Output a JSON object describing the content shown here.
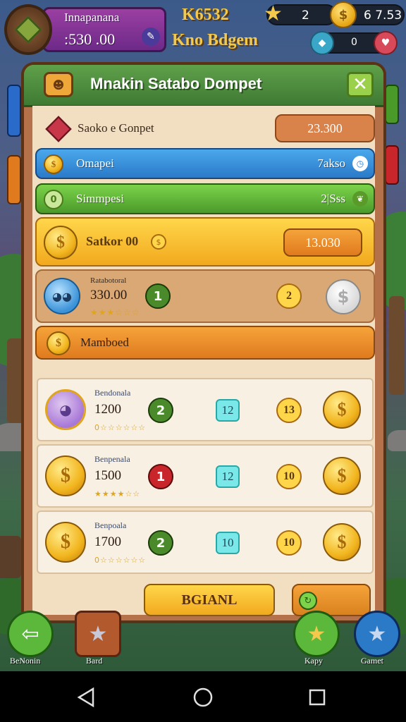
{
  "hud": {
    "player_name": "Innapanana",
    "player_balance": ":530 .00",
    "score_title": "K6532",
    "score_sub": "Kno Bdgem",
    "stars_count": "2",
    "coins_count": "6 7.53",
    "gems_count": "0"
  },
  "panel": {
    "title": "Mnakin Satabo Dompet",
    "header_row": {
      "label": "Saoko e Gonpet",
      "value": "23.300"
    },
    "blue_bar": {
      "label": "Omapei",
      "value": "7akso"
    },
    "green_bar": {
      "label": "Simmpesi",
      "value": "2|Sss"
    },
    "yellow_row": {
      "label": "Satkor 00",
      "value": "13.030"
    },
    "tan_row": {
      "name": "Ratabotoral",
      "amount": "330.00",
      "badge": "1",
      "stars": "★★★☆☆☆",
      "yellow_num": "2"
    },
    "orange_bar": {
      "label": "Mamboed"
    },
    "list": [
      {
        "name": "Bendonala",
        "amount": "1200",
        "badge": "2",
        "badge_color": "green",
        "stars": "0☆☆☆☆☆☆",
        "cyan": "12",
        "num": "13"
      },
      {
        "name": "Benpenala",
        "amount": "1500",
        "badge": "1",
        "badge_color": "red",
        "stars": "★★★★☆☆",
        "cyan": "12",
        "num": "10"
      },
      {
        "name": "Benpoala",
        "amount": "1700",
        "badge": "2",
        "badge_color": "green",
        "stars": "0☆☆☆☆☆☆",
        "cyan": "10",
        "num": "10"
      }
    ],
    "main_button": "BGIANL"
  },
  "nav": {
    "left_label": "BeNonin",
    "second_label": "Bard",
    "third_label": "Kapy",
    "right_label": "Gamet"
  },
  "colors": {
    "panel_bg": "#b5724a",
    "header_green": "#4f8f3e",
    "accent_gold": "#f2c94c"
  }
}
